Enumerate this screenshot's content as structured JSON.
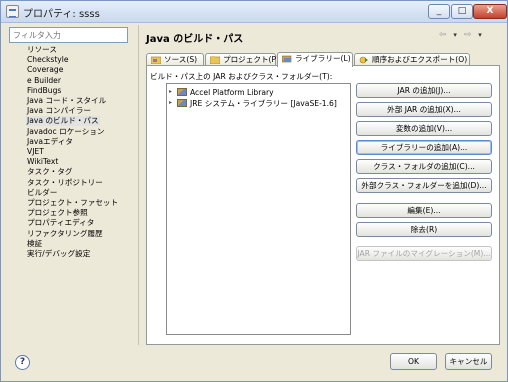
{
  "window": {
    "title": "プロパティ: ssss",
    "controls": {
      "minimize": "_",
      "maximize": "□",
      "close": "X"
    }
  },
  "filter": {
    "placeholder": "フィルタ入力"
  },
  "nav_tree": [
    {
      "label": "リソース",
      "child": false
    },
    {
      "label": "Checkstyle",
      "child": false
    },
    {
      "label": "Coverage",
      "child": false
    },
    {
      "label": "e Builder",
      "child": false
    },
    {
      "label": "FindBugs",
      "child": false
    },
    {
      "label": "Java コード・スタイル",
      "child": false
    },
    {
      "label": "Java コンパイラー",
      "child": false
    },
    {
      "label": "Java のビルド・パス",
      "child": false,
      "selected": true
    },
    {
      "label": "Javadoc ロケーション",
      "child": false
    },
    {
      "label": "Javaエディタ",
      "child": false
    },
    {
      "label": "VJET",
      "child": false
    },
    {
      "label": "WikiText",
      "child": false
    },
    {
      "label": "タスク・タグ",
      "child": false
    },
    {
      "label": "タスク・リポジトリー",
      "child": false
    },
    {
      "label": "ビルダー",
      "child": false
    },
    {
      "label": "プロジェクト・ファセット",
      "child": false
    },
    {
      "label": "プロジェクト参照",
      "child": false
    },
    {
      "label": "プロパティエディタ",
      "child": false
    },
    {
      "label": "リファクタリング履歴",
      "child": false
    },
    {
      "label": "検証",
      "child": false
    },
    {
      "label": "実行/デバッグ設定",
      "child": false
    }
  ],
  "page": {
    "title": "Java のビルド・パス",
    "nav": {
      "back": "⇦",
      "forward": "⇨",
      "menu": "▾"
    }
  },
  "tabs": [
    {
      "label": "ソース(S)",
      "active": false,
      "icon": "source-folder-icon"
    },
    {
      "label": "プロジェクト(P)",
      "active": false,
      "icon": "project-icon"
    },
    {
      "label": "ライブラリー(L)",
      "active": true,
      "icon": "library-icon"
    },
    {
      "label": "順序およびエクスポート(O)",
      "active": false,
      "icon": "order-export-icon"
    }
  ],
  "libraries": {
    "label": "ビルド・パス上の JAR およびクラス・フォルダー(T):",
    "items": [
      {
        "label": "Accel Platform Library",
        "icon": "library-jar-icon"
      },
      {
        "label": "JRE システム・ライブラリー [JavaSE-1.6]",
        "icon": "library-jar-icon"
      }
    ]
  },
  "buttons": [
    {
      "label": "JAR の追加(J)...",
      "enabled": true
    },
    {
      "label": "外部 JAR の追加(X)...",
      "enabled": true
    },
    {
      "label": "変数の追加(V)...",
      "enabled": true
    },
    {
      "label": "ライブラリーの追加(A)...",
      "enabled": true,
      "focused": true
    },
    {
      "label": "クラス・フォルダの追加(C)...",
      "enabled": true
    },
    {
      "label": "外部クラス・フォルダーを追加(D)...",
      "enabled": true
    },
    {
      "label": "編集(E)...",
      "enabled": true
    },
    {
      "label": "除去(R)",
      "enabled": true
    },
    {
      "label": "JAR ファイルのマイグレーション(M)...",
      "enabled": false
    }
  ],
  "footer": {
    "help": "?",
    "ok": "OK",
    "cancel": "キャンセル"
  },
  "colors": {
    "dialog_bg": "#ece9d8",
    "focus_border": "#5a8ad0",
    "disabled_text": "#a4a4a4"
  }
}
